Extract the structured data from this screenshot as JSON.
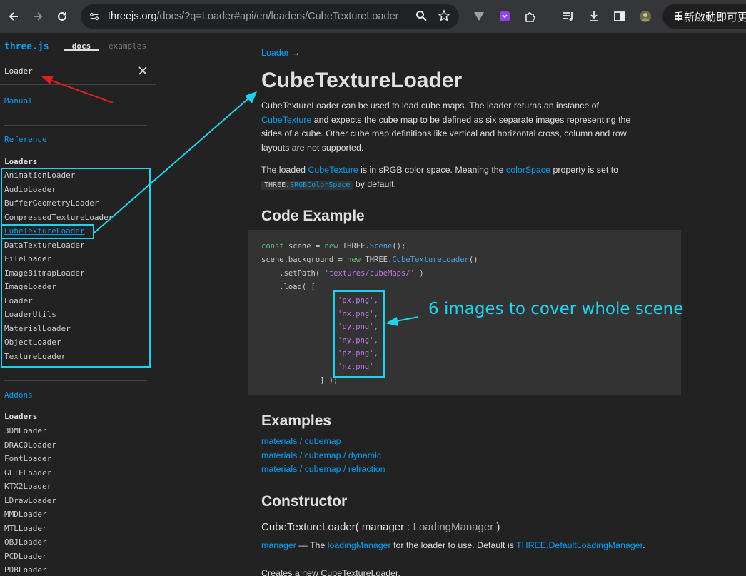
{
  "browser": {
    "url_host": "threejs.org",
    "url_path": "/docs/?q=Loader#api/en/loaders/CubeTextureLoader",
    "update_label": "重新啟動即可更"
  },
  "sidebar": {
    "title": "three.js",
    "tab_docs": "docs",
    "tab_examples": "examples",
    "search_value": "Loader",
    "manual_label": "Manual",
    "reference_label": "Reference",
    "loaders_heading": "Loaders",
    "loaders": [
      "AnimationLoader",
      "AudioLoader",
      "BufferGeometryLoader",
      "CompressedTextureLoader",
      "CubeTextureLoader",
      "DataTextureLoader",
      "FileLoader",
      "ImageBitmapLoader",
      "ImageLoader",
      "Loader",
      "LoaderUtils",
      "MaterialLoader",
      "ObjectLoader",
      "TextureLoader"
    ],
    "addons_label": "Addons",
    "addon_loaders_heading": "Loaders",
    "addon_loaders": [
      "3DMLoader",
      "DRACOLoader",
      "FontLoader",
      "GLTFLoader",
      "KTX2Loader",
      "LDrawLoader",
      "MMDLoader",
      "MTLLoader",
      "OBJLoader",
      "PCDLoader",
      "PDBLoader"
    ]
  },
  "content": {
    "breadcrumb": "Loader",
    "breadcrumb_arrow": "→",
    "title": "CubeTextureLoader",
    "intro_1": "CubeTextureLoader can be used to load cube maps. The loader returns an instance of",
    "intro_link": "CubeTexture",
    "intro_2": " and expects the cube map to be defined as six separate images representing the sides of a cube. Other cube map definitions like vertical and horizontal cross, column and row layouts are not supported.",
    "color_1": "The loaded ",
    "color_link": "CubeTexture",
    "color_2": " is in sRGB color space. Meaning the ",
    "color_link2": "colorSpace",
    "color_3": " property is set to",
    "color_code_prefix": "THREE.",
    "color_code_link": "SRGBColorSpace",
    "color_4": " by default.",
    "code_example_heading": "Code Example",
    "code": {
      "l1_kw": "const",
      "l1_a": " scene = ",
      "l1_new": "new",
      "l1_b": " THREE.",
      "l1_cls": "Scene",
      "l1_c": "();",
      "l2_a": "scene.background = ",
      "l2_new": "new",
      "l2_b": " THREE.",
      "l2_cls": "CubeTextureLoader",
      "l2_c": "()",
      "l3_a": "    .setPath( ",
      "l3_str": "'textures/cubeMaps/'",
      "l3_b": " )",
      "l4": "    .load( [",
      "files": [
        "'px.png',",
        "'nx.png',",
        "'py.png',",
        "'ny.png',",
        "'pz.png',",
        "'nz.png'"
      ],
      "close": "] );"
    },
    "examples_heading": "Examples",
    "examples": [
      "materials / cubemap",
      "materials / cubemap / dynamic",
      "materials / cubemap / refraction"
    ],
    "constructor_heading": "Constructor",
    "ctor_name": "CubeTextureLoader( manager : ",
    "ctor_type": "LoadingManager",
    "ctor_close": " )",
    "param_name": "manager",
    "param_text_1": " — The ",
    "param_link": "loadingManager",
    "param_text_2": " for the loader to use. Default is ",
    "param_default": "THREE.DefaultLoadingManager",
    "param_end": ".",
    "creates_text": "Creates a new CubeTextureLoader."
  },
  "annotation": {
    "label": "6 images to cover whole scene",
    "color": "#1fd3ef",
    "arrow_color": "#e01f1f"
  }
}
